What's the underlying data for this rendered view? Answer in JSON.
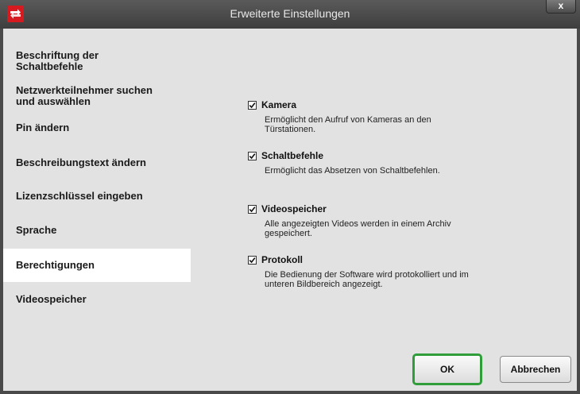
{
  "window": {
    "title": "Erweiterte Einstellungen",
    "close_label": "x"
  },
  "icons": {
    "app": "app-logo-icon",
    "close": "close-icon",
    "checkbox": "checkmark-icon"
  },
  "sidebar": {
    "items": [
      {
        "label_line1": "Beschriftung der",
        "label_line2": "Schaltbefehle",
        "active": false
      },
      {
        "label_line1": "Netzwerkteilnehmer suchen",
        "label_line2": "und auswählen",
        "active": false
      },
      {
        "label_line1": "Pin ändern",
        "label_line2": "",
        "active": false
      },
      {
        "label_line1": "Beschreibungstext ändern",
        "label_line2": "",
        "active": false
      },
      {
        "label_line1": "Lizenzschlüssel eingeben",
        "label_line2": "",
        "active": false
      },
      {
        "label_line1": "Sprache",
        "label_line2": "",
        "active": false
      },
      {
        "label_line1": "Berechtigungen",
        "label_line2": "",
        "active": true
      },
      {
        "label_line1": "Videospeicher",
        "label_line2": "",
        "active": false
      }
    ]
  },
  "permissions": [
    {
      "label": "Kamera",
      "checked": true,
      "desc_line1": "Ermöglicht den Aufruf von Kameras an den",
      "desc_line2": "Türstationen."
    },
    {
      "label": "Schaltbefehle",
      "checked": true,
      "desc_line1": "Ermöglicht das Absetzen von Schaltbefehlen.",
      "desc_line2": ""
    },
    {
      "label": "Videospeicher",
      "checked": true,
      "desc_line1": "Alle angezeigten Videos werden in einem Archiv",
      "desc_line2": "gespeichert."
    },
    {
      "label": "Protokoll",
      "checked": true,
      "desc_line1": "Die Bedienung der Software wird protokolliert und im",
      "desc_line2": "unteren Bildbereich angezeigt."
    }
  ],
  "buttons": {
    "ok": "OK",
    "cancel": "Abbrechen"
  },
  "colors": {
    "brand": "#d71920",
    "ok_focus": "#2f9e3a",
    "background": "#e2e2e2",
    "titlebar": "#4a4a4a"
  }
}
